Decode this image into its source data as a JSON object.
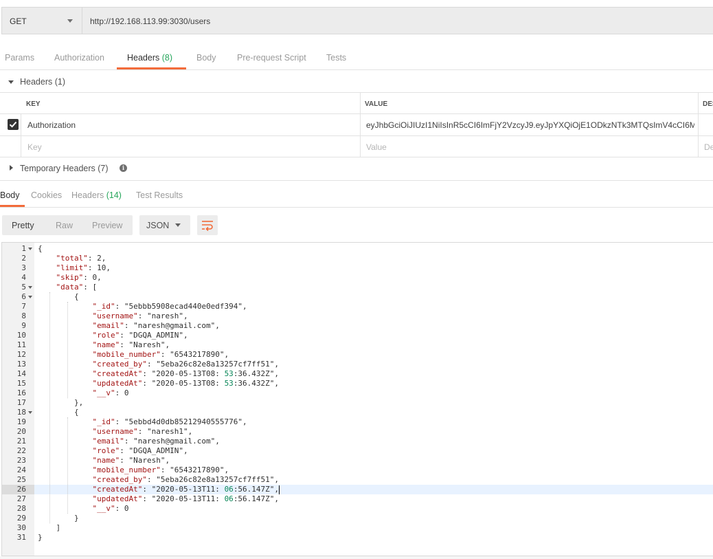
{
  "request": {
    "method": "GET",
    "url": "http://192.168.113.99:3030/users"
  },
  "request_tabs": [
    {
      "label": "Params"
    },
    {
      "label": "Authorization"
    },
    {
      "label": "Headers",
      "count": "(8)",
      "active": true
    },
    {
      "label": "Body"
    },
    {
      "label": "Pre-request Script"
    },
    {
      "label": "Tests"
    }
  ],
  "headers_section": {
    "title": "Headers (1)",
    "columns": {
      "key": "KEY",
      "value": "VALUE",
      "description": "DES"
    },
    "rows": [
      {
        "checked": true,
        "key": "Authorization",
        "value": "eyJhbGciOiJIUzI1NiIsInR5cCI6ImFjY2VzcyJ9.eyJpYXQiOjE1ODkzNTk3MTQsImV4cCI6M..."
      }
    ],
    "placeholders": {
      "key": "Key",
      "value": "Value",
      "description": "De"
    }
  },
  "temporary_headers": {
    "title": "Temporary Headers (7)"
  },
  "response_tabs": [
    {
      "label": "Body",
      "active": true
    },
    {
      "label": "Cookies"
    },
    {
      "label": "Headers",
      "count": "(14)"
    },
    {
      "label": "Test Results"
    }
  ],
  "view_modes": {
    "pretty": "Pretty",
    "raw": "Raw",
    "preview": "Preview",
    "selected": "Pretty"
  },
  "format": {
    "selected": "JSON"
  },
  "icons": {
    "wrap": "wrap-lines-icon",
    "info": "info-icon",
    "check": "checkmark-icon"
  },
  "colors": {
    "accent": "#f26b3a",
    "count": "#26a65b"
  },
  "response_json": {
    "cursor_line": 26,
    "lines": [
      "{",
      "    \"total\": 2,",
      "    \"limit\": 10,",
      "    \"skip\": 0,",
      "    \"data\": [",
      "        {",
      "            \"_id\": \"5ebbb5908ecad440e0edf394\",",
      "            \"username\": \"naresh\",",
      "            \"email\": \"naresh@gmail.com\",",
      "            \"role\": \"DGQA_ADMIN\",",
      "            \"name\": \"Naresh\",",
      "            \"mobile_number\": \"6543217890\",",
      "            \"created_by\": \"5eba26c82e8a13257cf7ff51\",",
      "            \"createdAt\": \"2020-05-13T08:53:36.432Z\",",
      "            \"updatedAt\": \"2020-05-13T08:53:36.432Z\",",
      "            \"__v\": 0",
      "        },",
      "        {",
      "            \"_id\": \"5ebbd4d0db85212940555776\",",
      "            \"username\": \"naresh1\",",
      "            \"email\": \"naresh@gmail.com\",",
      "            \"role\": \"DGQA_ADMIN\",",
      "            \"name\": \"Naresh\",",
      "            \"mobile_number\": \"6543217890\",",
      "            \"created_by\": \"5eba26c82e8a13257cf7ff51\",",
      "            \"createdAt\": \"2020-05-13T11:06:56.147Z\",",
      "            \"updatedAt\": \"2020-05-13T11:06:56.147Z\",",
      "            \"__v\": 0",
      "        }",
      "    ]",
      "}"
    ],
    "foldable_lines": [
      1,
      5,
      6,
      18
    ]
  }
}
